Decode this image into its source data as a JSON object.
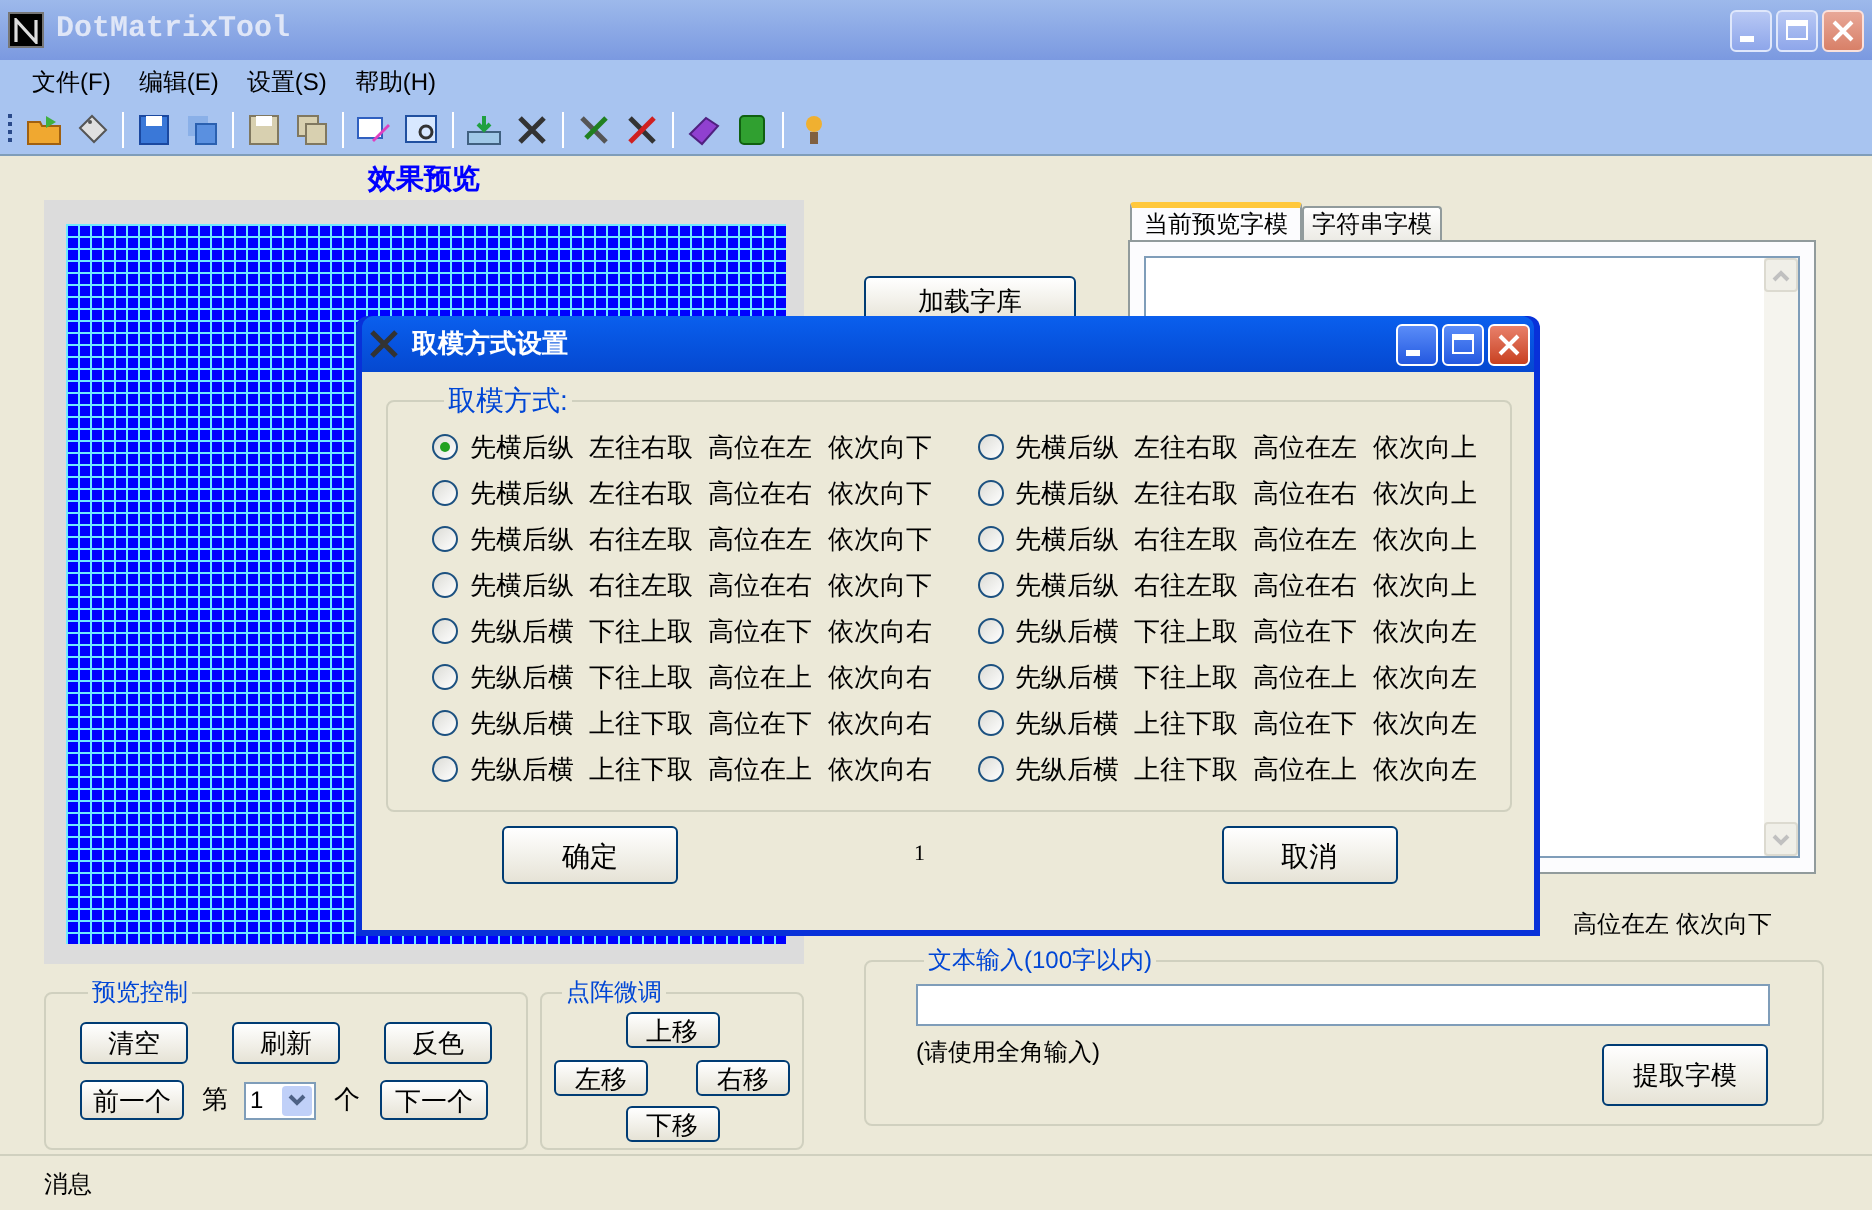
{
  "window": {
    "title": "DotMatrixTool"
  },
  "menu": [
    {
      "label": "文件(F)"
    },
    {
      "label": "编辑(E)"
    },
    {
      "label": "设置(S)"
    },
    {
      "label": "帮助(H)"
    }
  ],
  "preview": {
    "title": "效果预览"
  },
  "preview_control": {
    "title": "预览控制",
    "buttons": [
      "清空",
      "刷新",
      "反色"
    ],
    "prev_button": "前一个",
    "index_prefix": "第",
    "index_value": "1",
    "index_suffix": "个",
    "next_button": "下一个"
  },
  "fine_tune": {
    "title": "点阵微调",
    "up": "上移",
    "left": "左移",
    "right": "右移",
    "down": "下移"
  },
  "load_font_button": "加载字库",
  "tabs": [
    {
      "label": "当前预览字模",
      "selected": true
    },
    {
      "label": "字符串字模",
      "selected": false
    }
  ],
  "mode_summary": "高位在左 依次向下",
  "text_input": {
    "title": "文本输入(100字以内)",
    "hint_text": "(请使用全角输入)",
    "button": "提取字模"
  },
  "status_bar": {
    "label": "消息"
  },
  "dialog": {
    "title": "取模方式设置",
    "group_title": "取模方式:",
    "options": [
      {
        "label": "先横后纵 左往右取 高位在左 依次向下",
        "selected": true
      },
      {
        "label": "先横后纵 左往右取 高位在左 依次向上",
        "selected": false
      },
      {
        "label": "先横后纵 左往右取 高位在右 依次向下",
        "selected": false
      },
      {
        "label": "先横后纵 左往右取 高位在右 依次向上",
        "selected": false
      },
      {
        "label": "先横后纵 右往左取 高位在左 依次向下",
        "selected": false
      },
      {
        "label": "先横后纵 右往左取 高位在左 依次向上",
        "selected": false
      },
      {
        "label": "先横后纵 右往左取 高位在右 依次向下",
        "selected": false
      },
      {
        "label": "先横后纵 右往左取 高位在右 依次向上",
        "selected": false
      },
      {
        "label": "先纵后横 下往上取 高位在下 依次向右",
        "selected": false
      },
      {
        "label": "先纵后横 下往上取 高位在下 依次向左",
        "selected": false
      },
      {
        "label": "先纵后横 下往上取 高位在上 依次向右",
        "selected": false
      },
      {
        "label": "先纵后横 下往上取 高位在上 依次向左",
        "selected": false
      },
      {
        "label": "先纵后横 上往下取 高位在下 依次向右",
        "selected": false
      },
      {
        "label": "先纵后横 上往下取 高位在下 依次向左",
        "selected": false
      },
      {
        "label": "先纵后横 上往下取 高位在上 依次向右",
        "selected": false
      },
      {
        "label": "先纵后横 上往下取 高位在上 依次向左",
        "selected": false
      }
    ],
    "ok_button": "确定",
    "counter": "1",
    "cancel_button": "取消"
  }
}
